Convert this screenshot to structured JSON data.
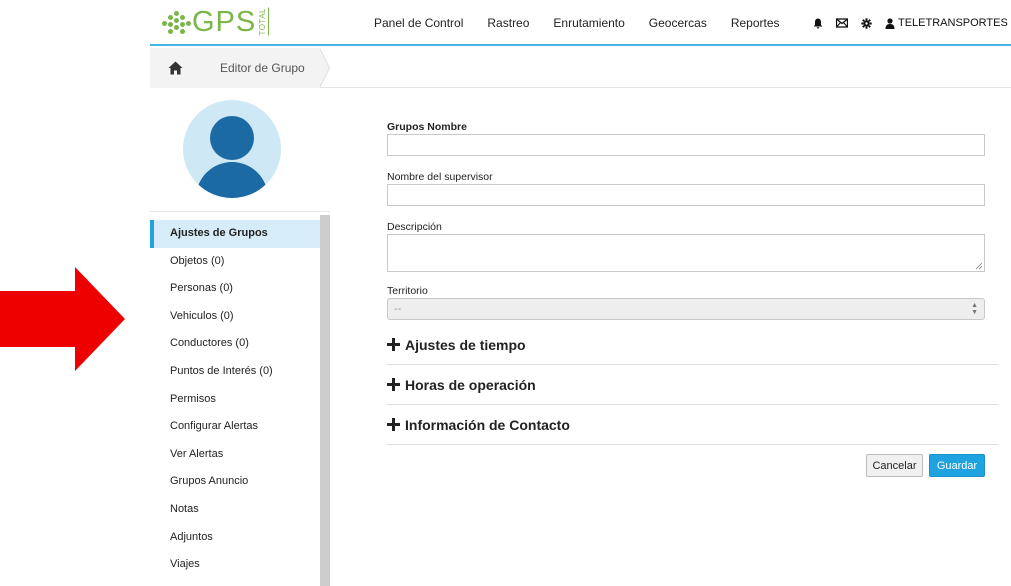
{
  "brand": {
    "name": "GPS",
    "sub": "TOTAL",
    "color": "#7ab648"
  },
  "nav": {
    "links": [
      "Panel de Control",
      "Rastreo",
      "Enrutamiento",
      "Geocercas",
      "Reportes"
    ],
    "icons": [
      "bell-icon",
      "envelope-icon",
      "gear-icon",
      "user-icon"
    ],
    "user": "TELETRANSPORTES II"
  },
  "breadcrumb": {
    "home_icon": "home-icon",
    "page": "Editor de Grupo"
  },
  "sidebar": {
    "items": [
      {
        "label": "Ajustes de Grupos",
        "active": true
      },
      {
        "label": "Objetos (0)"
      },
      {
        "label": "Personas (0)"
      },
      {
        "label": "Vehiculos (0)"
      },
      {
        "label": "Conductores (0)"
      },
      {
        "label": "Puntos de Interés (0)"
      },
      {
        "label": "Permisos"
      },
      {
        "label": "Configurar Alertas"
      },
      {
        "label": "Ver Alertas"
      },
      {
        "label": "Grupos Anuncio"
      },
      {
        "label": "Notas"
      },
      {
        "label": "Adjuntos"
      },
      {
        "label": "Viajes"
      }
    ]
  },
  "form": {
    "group_name_label": "Grupos Nombre",
    "group_name_value": "",
    "supervisor_label": "Nombre del supervisor",
    "supervisor_value": "",
    "description_label": "Descripción",
    "description_value": "",
    "territory_label": "Territorio",
    "territory_value": "--",
    "sections": [
      "Ajustes de tiempo",
      "Horas de operación",
      "Información de Contacto"
    ],
    "cancel_label": "Cancelar",
    "save_label": "Guardar"
  },
  "colors": {
    "accent": "#1ea3e0",
    "arrow": "#ee0000",
    "avatar": "#1b6aa3"
  }
}
